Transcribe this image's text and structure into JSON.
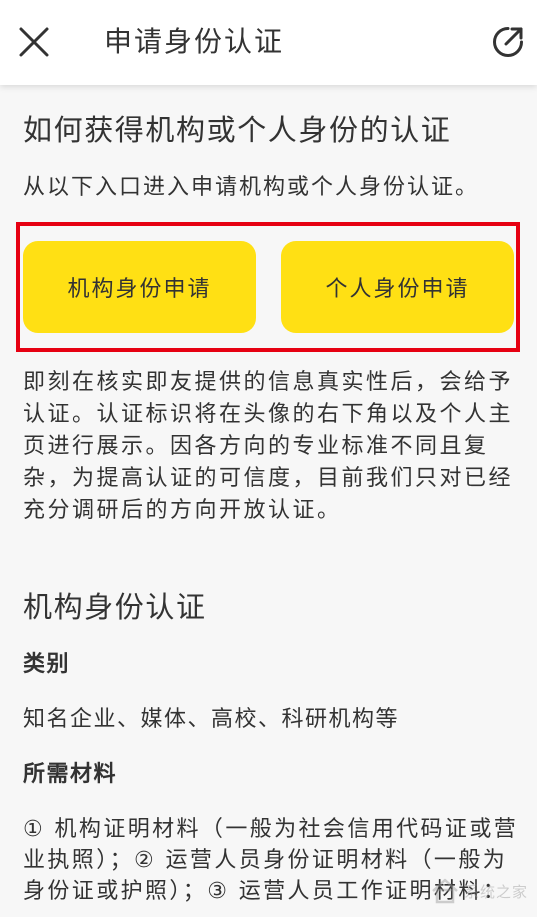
{
  "header": {
    "title": "申请身份认证",
    "close_icon": "close-icon",
    "share_icon": "external-link-icon"
  },
  "intro": {
    "heading": "如何获得机构或个人身份的认证",
    "subtitle": "从以下入口进入申请机构或个人身份认证。",
    "buttons": [
      {
        "label": "机构身份申请"
      },
      {
        "label": "个人身份申请"
      }
    ],
    "description_lines": [
      "即刻在核实即友提供的信息真实性后，会给予",
      "认证。认证标识将在头像的右下角以及个人主",
      "页进行展示。因各方向的专业标准不同且复",
      "杂，为提高认证的可信度，目前我们只对已经",
      "充分调研后的方向开放认证。"
    ]
  },
  "org_section": {
    "heading": "机构身份认证",
    "category_label": "类别",
    "category_value": "知名企业、媒体、高校、科研机构等",
    "materials_label": "所需材料",
    "materials_lines": [
      "① 机构证明材料（一般为社会信用代码证或营",
      "业执照）；② 运营人员身份证明材料（一般为",
      "身份证或护照）；③ 运营人员工作证明材料："
    ]
  },
  "watermark": {
    "text": "系统之家"
  },
  "colors": {
    "highlight_border": "#e60012",
    "button_yellow": "#ffe014",
    "text": "#333333",
    "background": "#f7f7f7",
    "header_background": "#ffffff"
  }
}
